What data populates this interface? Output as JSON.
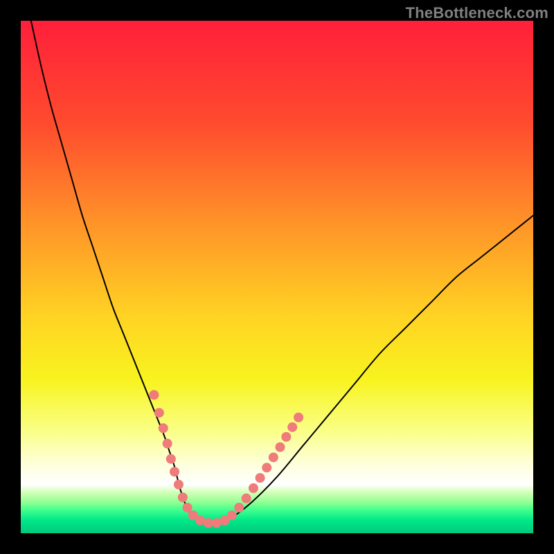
{
  "watermark": "TheBottleneck.com",
  "chart_data": {
    "type": "line",
    "title": "",
    "xlabel": "",
    "ylabel": "",
    "xlim": [
      0,
      100
    ],
    "ylim": [
      0,
      100
    ],
    "grid": false,
    "legend": false,
    "background_gradient": {
      "direction": "vertical",
      "stops": [
        {
          "pos": 0.0,
          "color": "#ff1f3a"
        },
        {
          "pos": 0.2,
          "color": "#ff4b2e"
        },
        {
          "pos": 0.4,
          "color": "#ff9528"
        },
        {
          "pos": 0.58,
          "color": "#ffd423"
        },
        {
          "pos": 0.7,
          "color": "#f8f31f"
        },
        {
          "pos": 0.8,
          "color": "#faff86"
        },
        {
          "pos": 0.86,
          "color": "#fdffd5"
        },
        {
          "pos": 0.905,
          "color": "#ffffff"
        },
        {
          "pos": 0.92,
          "color": "#d4ffb8"
        },
        {
          "pos": 0.94,
          "color": "#8fff93"
        },
        {
          "pos": 0.955,
          "color": "#3fff8e"
        },
        {
          "pos": 0.975,
          "color": "#00e889"
        },
        {
          "pos": 1.0,
          "color": "#00c97b"
        }
      ]
    },
    "series": [
      {
        "name": "bottleneck-curve",
        "color": "#000000",
        "stroke_width": 2,
        "x": [
          2,
          4,
          6,
          8,
          10,
          12,
          14,
          16,
          18,
          20,
          22,
          24,
          26,
          28,
          29,
          30,
          31,
          32,
          33,
          34,
          36,
          38,
          41,
          45,
          50,
          55,
          60,
          65,
          70,
          75,
          80,
          85,
          90,
          95,
          100
        ],
        "y": [
          100,
          91,
          83,
          76,
          69,
          62,
          56,
          50,
          44,
          39,
          34,
          29,
          24,
          19,
          16,
          13,
          9,
          6,
          4,
          3,
          2,
          2,
          3,
          6,
          11,
          17,
          23,
          29,
          35,
          40,
          45,
          50,
          54,
          58,
          62
        ]
      }
    ],
    "markers": {
      "name": "highlight-beads",
      "color": "#ef7b7b",
      "radius": 7,
      "points": [
        {
          "x": 26.0,
          "y": 27.0
        },
        {
          "x": 27.0,
          "y": 23.5
        },
        {
          "x": 27.8,
          "y": 20.5
        },
        {
          "x": 28.6,
          "y": 17.5
        },
        {
          "x": 29.3,
          "y": 14.5
        },
        {
          "x": 30.0,
          "y": 12.0
        },
        {
          "x": 30.8,
          "y": 9.5
        },
        {
          "x": 31.6,
          "y": 7.0
        },
        {
          "x": 32.5,
          "y": 5.0
        },
        {
          "x": 33.6,
          "y": 3.5
        },
        {
          "x": 35.0,
          "y": 2.5
        },
        {
          "x": 36.6,
          "y": 2.0
        },
        {
          "x": 38.2,
          "y": 2.0
        },
        {
          "x": 39.8,
          "y": 2.5
        },
        {
          "x": 41.2,
          "y": 3.5
        },
        {
          "x": 42.6,
          "y": 5.0
        },
        {
          "x": 44.0,
          "y": 6.8
        },
        {
          "x": 45.4,
          "y": 8.8
        },
        {
          "x": 46.7,
          "y": 10.8
        },
        {
          "x": 48.0,
          "y": 12.8
        },
        {
          "x": 49.3,
          "y": 14.8
        },
        {
          "x": 50.6,
          "y": 16.8
        },
        {
          "x": 51.8,
          "y": 18.8
        },
        {
          "x": 53.0,
          "y": 20.7
        },
        {
          "x": 54.2,
          "y": 22.6
        }
      ]
    }
  }
}
